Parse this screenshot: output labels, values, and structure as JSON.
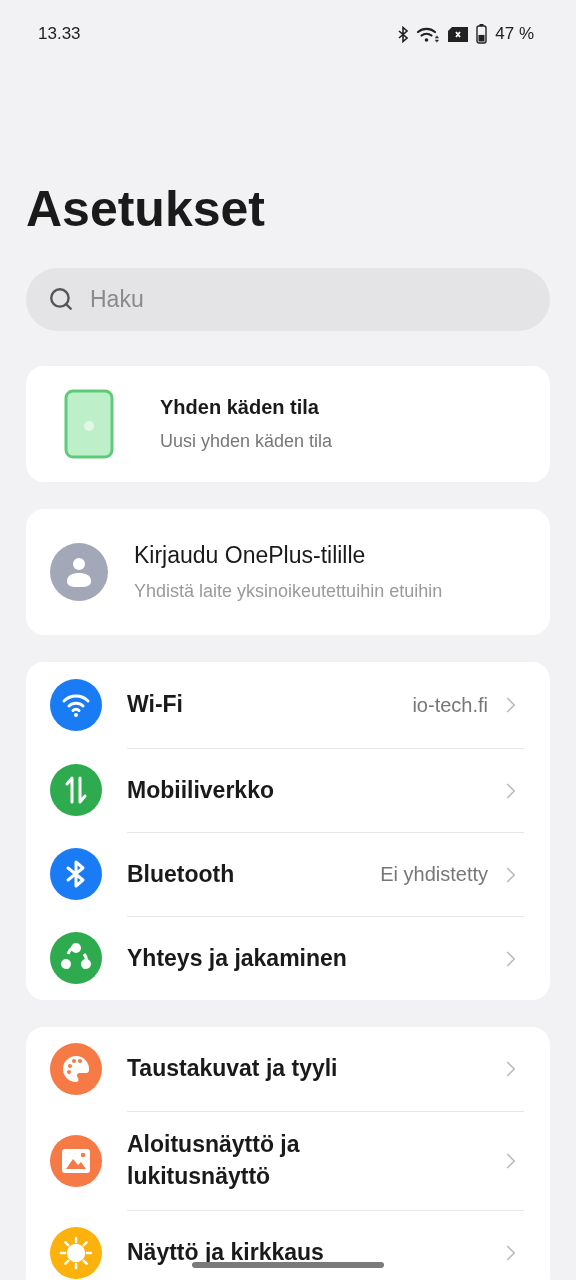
{
  "status_bar": {
    "time": "13.33",
    "battery_text": "47 %"
  },
  "title": "Asetukset",
  "search": {
    "placeholder": "Haku"
  },
  "promo": {
    "title": "Yhden käden tila",
    "subtitle": "Uusi yhden käden tila"
  },
  "account": {
    "title": "Kirjaudu OnePlus-tilille",
    "subtitle": "Yhdistä laite yksinoikeutettuihin etuihin"
  },
  "groups": [
    {
      "items": [
        {
          "kind": "wifi",
          "color": "#1a7cf5",
          "label": "Wi-Fi",
          "value": "io-tech.fi"
        },
        {
          "kind": "mobile",
          "color": "#2fab4f",
          "label": "Mobiiliverkko"
        },
        {
          "kind": "bluetooth",
          "color": "#1a7cf5",
          "label": "Bluetooth",
          "value": "Ei yhdistetty"
        },
        {
          "kind": "share",
          "color": "#2fab4f",
          "label": "Yhteys ja jakaminen"
        }
      ]
    },
    {
      "items": [
        {
          "kind": "palette",
          "color": "#f57a45",
          "label": "Taustakuvat ja tyyli"
        },
        {
          "kind": "image",
          "color": "#f57a45",
          "label": "Aloitusnäyttö ja\nlukitusnäyttö"
        },
        {
          "kind": "sun",
          "color": "#fbb20d",
          "label": "Näyttö ja kirkkaus"
        }
      ]
    }
  ]
}
